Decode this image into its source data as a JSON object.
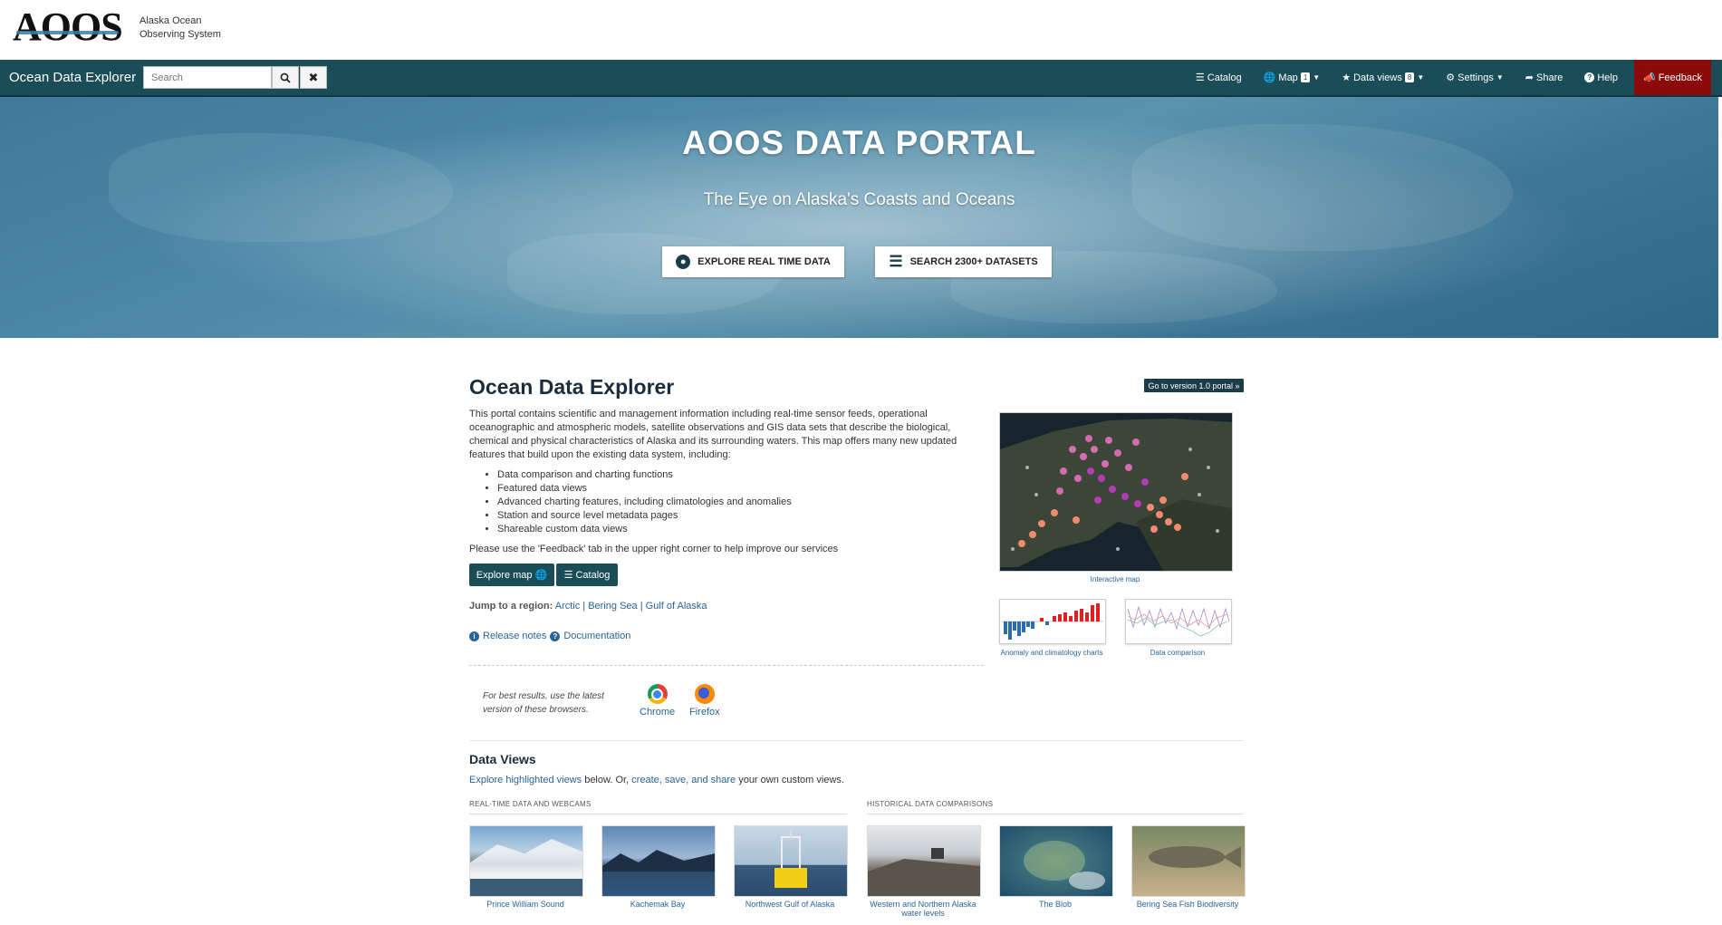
{
  "brand": {
    "logo_text": "AOOS",
    "subtitle_line1": "Alaska Ocean",
    "subtitle_line2": "Observing System"
  },
  "navbar": {
    "title": "Ocean Data Explorer",
    "search_placeholder": "Search",
    "items": [
      {
        "label": "Catalog",
        "icon": "list-icon"
      },
      {
        "label": "Map",
        "icon": "globe-icon",
        "badge": "1"
      },
      {
        "label": "Data views",
        "icon": "star-icon",
        "badge": "8"
      },
      {
        "label": "Settings",
        "icon": "gear-icon"
      },
      {
        "label": "Share",
        "icon": "share-icon"
      },
      {
        "label": "Help",
        "icon": "question-icon"
      }
    ],
    "feedback": "Feedback"
  },
  "hero": {
    "title": "AOOS DATA PORTAL",
    "subtitle": "The Eye on Alaska's Coasts and Oceans",
    "btn_explore": "EXPLORE REAL TIME DATA",
    "btn_search": "SEARCH 2300+ DATASETS"
  },
  "main": {
    "title": "Ocean Data Explorer",
    "v1_button": "Go to version 1.0 portal »",
    "intro": "This portal contains scientific and management information including real-time sensor feeds, operational oceanographic and atmospheric models, satellite observations and GIS data sets that describe the biological, chemical and physical characteristics of Alaska and its surrounding waters. This map offers many new updated features that build upon the existing data system, including:",
    "features": [
      "Data comparison and charting functions",
      "Featured data views",
      "Advanced charting features, including climatologies and anomalies",
      "Station and source level metadata pages",
      "Shareable custom data views"
    ],
    "note": "Please use the 'Feedback' tab in the upper right corner to help improve our services",
    "btn_explore_map": "Explore map",
    "btn_catalog": "Catalog",
    "jump_label": "Jump to a region:",
    "regions": [
      "Arctic",
      "Bering Sea",
      "Gulf of Alaska"
    ],
    "region_sep": "|",
    "release_notes": "Release notes",
    "documentation": "Documentation",
    "best_results": "For best results, use the latest version of these browsers.",
    "browsers": [
      "Chrome",
      "Firefox"
    ]
  },
  "previews": {
    "map_caption": "Interactive map",
    "anomaly_caption": "Anomaly and climatology charts",
    "comparison_caption": "Data comparison"
  },
  "data_views": {
    "title": "Data Views",
    "desc_link1": "Explore highlighted views",
    "desc_mid": " below. Or, ",
    "desc_link2": "create, save, and share",
    "desc_end": " your own custom views.",
    "section_realtime": "REAL-TIME DATA AND WEBCAMS",
    "section_historical": "HISTORICAL DATA COMPARISONS",
    "items": [
      "Prince William Sound",
      "Kachemak Bay",
      "Northwest Gulf of Alaska",
      "Western and Northern Alaska water levels",
      "The Blob",
      "Bering Sea Fish Biodiversity"
    ]
  },
  "colors": {
    "navbar": "#1b4d59",
    "feedback": "#8b0b0b",
    "link": "#2a6496"
  }
}
